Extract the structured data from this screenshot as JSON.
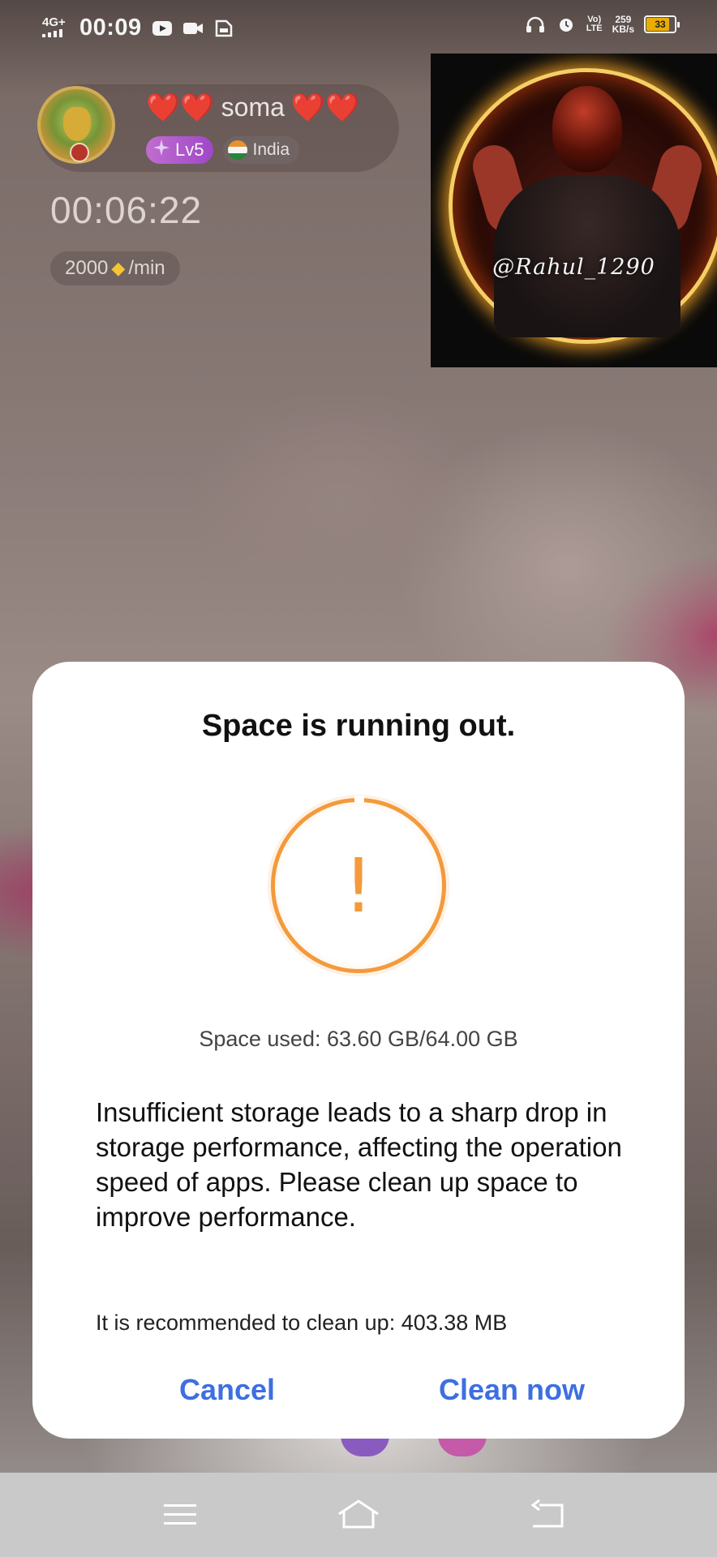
{
  "status_bar": {
    "network": "4G+",
    "time": "00:09",
    "speed_value": "259",
    "speed_unit": "KB/s",
    "volte_top": "Vo)",
    "volte_bottom": "LTE",
    "battery_level": "33",
    "icons": [
      "signal-icon",
      "youtube-icon",
      "video-camera-icon",
      "sim-icon",
      "headphones-icon",
      "alarm-icon",
      "battery-icon"
    ]
  },
  "host": {
    "name": "soma",
    "hearts": "❤️❤️",
    "level": "Lv5",
    "country": "India"
  },
  "call": {
    "timer": "00:06:22",
    "rate_amount": "2000",
    "rate_unit": "/min"
  },
  "self_preview": {
    "handle": "@Rahul_1290"
  },
  "dialog": {
    "title": "Space is running out.",
    "space_used": "Space used: 63.60 GB/64.00 GB",
    "message": "Insufficient storage leads to a sharp drop in storage performance, affecting the operation speed of apps. Please clean up space to improve performance.",
    "recommendation": "It is recommended to clean up: 403.38 MB",
    "cancel_label": "Cancel",
    "clean_label": "Clean now",
    "accent_color": "#f39a3c",
    "button_color": "#3d6fe0"
  },
  "nav_bar": {
    "items": [
      "menu-icon",
      "home-icon",
      "back-icon"
    ]
  }
}
